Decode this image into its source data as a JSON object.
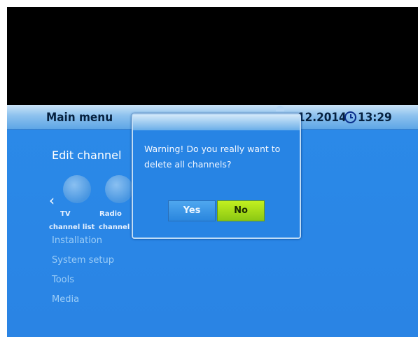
{
  "header": {
    "title": "Main menu",
    "date": "12.2014",
    "time": "13:29"
  },
  "menu": {
    "section_title": "Edit channel",
    "chevron": "‹",
    "tiles": [
      {
        "label_top": "TV",
        "label_bottom": "channel list",
        "icon": "tv-icon"
      },
      {
        "label_top": "Radio",
        "label_bottom": "channel li",
        "icon": "radio-icon"
      }
    ],
    "items": [
      "Installation",
      "System setup",
      "Tools",
      "Media"
    ]
  },
  "dialog": {
    "message": "Warning! Do you really want to delete all channels?",
    "yes_label": "Yes",
    "no_label": "No"
  },
  "colors": {
    "background": "#2a86e6",
    "selected_button": "#b2e31e"
  }
}
